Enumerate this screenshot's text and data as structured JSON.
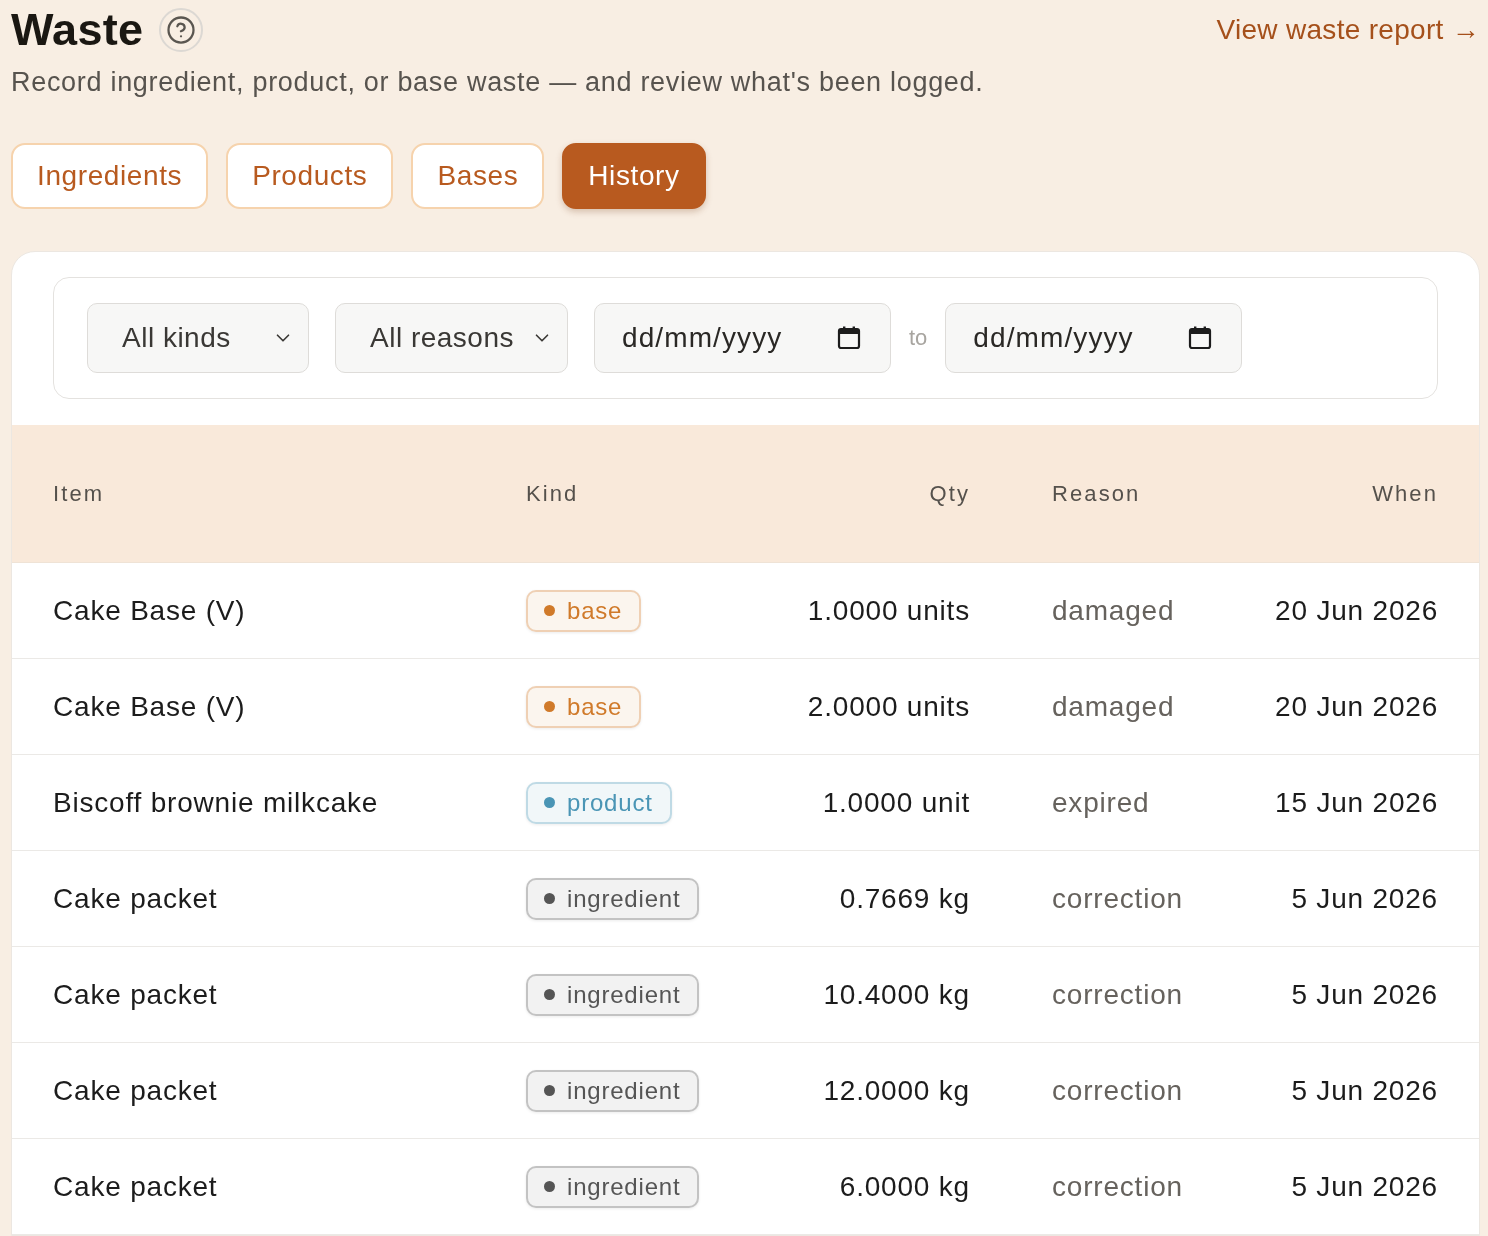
{
  "header": {
    "title": "Waste",
    "subtitle": "Record ingredient, product, or base waste — and review what's been logged.",
    "report_link": "View waste report →"
  },
  "tabs": [
    {
      "label": "Ingredients",
      "selected": false
    },
    {
      "label": "Products",
      "selected": false
    },
    {
      "label": "Bases",
      "selected": false
    },
    {
      "label": "History",
      "selected": true
    }
  ],
  "filters": {
    "kind_select": "All kinds",
    "reason_select": "All reasons",
    "date_from": {
      "placeholder": "dd/mm/yyyy"
    },
    "separator": "to",
    "date_to": {
      "placeholder": "dd/mm/yyyy"
    }
  },
  "table": {
    "columns": [
      "Item",
      "Kind",
      "Qty",
      "Reason",
      "When"
    ],
    "rows": [
      {
        "item": "Cake Base (V)",
        "tag": {
          "text": "base",
          "color": "#d07a2a"
        },
        "qty": "1.0000 units",
        "reason": "damaged",
        "when": "20 Jun 2026"
      },
      {
        "item": "Cake Base (V)",
        "tag": {
          "text": "base",
          "color": "#d07a2a"
        },
        "qty": "2.0000 units",
        "reason": "damaged",
        "when": "20 Jun 2026"
      },
      {
        "item": "Biscoff brownie milkcake",
        "tag": {
          "text": "product",
          "color": "#4a95b5"
        },
        "qty": "1.0000 unit",
        "reason": "expired",
        "when": "15 Jun 2026"
      },
      {
        "item": "Cake packet",
        "tag": {
          "text": "ingredient",
          "color": "#555555"
        },
        "qty": "0.7669 kg",
        "reason": "correction",
        "when": "5 Jun 2026"
      },
      {
        "item": "Cake packet",
        "tag": {
          "text": "ingredient",
          "color": "#555555"
        },
        "qty": "10.4000 kg",
        "reason": "correction",
        "when": "5 Jun 2026"
      },
      {
        "item": "Cake packet",
        "tag": {
          "text": "ingredient",
          "color": "#555555"
        },
        "qty": "12.0000 kg",
        "reason": "correction",
        "when": "5 Jun 2026"
      },
      {
        "item": "Cake packet",
        "tag": {
          "text": "ingredient",
          "color": "#555555"
        },
        "qty": "6.0000 kg",
        "reason": "correction",
        "when": "5 Jun 2026"
      }
    ]
  }
}
